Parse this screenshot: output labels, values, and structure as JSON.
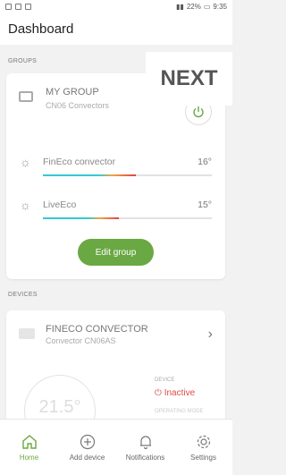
{
  "status_bar": {
    "battery": "22%",
    "time": "9:35"
  },
  "header": {
    "title": "Dashboard"
  },
  "overlay": {
    "text": "NEXT"
  },
  "groups": {
    "label": "GROUPS",
    "group": {
      "name": "MY GROUP",
      "subtitle": "CN06 Convectors",
      "convectors": [
        {
          "name": "FinEco convector",
          "temp": "16°",
          "level": 0.55
        },
        {
          "name": "LiveEco",
          "temp": "15°",
          "level": 0.45
        }
      ],
      "edit_label": "Edit group"
    }
  },
  "devices": {
    "label": "DEVICES",
    "device": {
      "name": "FINECO CONVECTOR",
      "subtitle": "Convector CN06AS",
      "temp": "21.5°",
      "status_label": "DEVICE",
      "status": "Inactive",
      "extra_label": "OPERATING MODE"
    }
  },
  "tabbar": [
    {
      "label": "Home",
      "icon": "home-icon",
      "active": true
    },
    {
      "label": "Add device",
      "icon": "add-icon",
      "active": false
    },
    {
      "label": "Notifications",
      "icon": "bell-icon",
      "active": false
    },
    {
      "label": "Settings",
      "icon": "gear-icon",
      "active": false
    }
  ],
  "colors": {
    "accent": "#6aa843",
    "inactive": "#e04a4a",
    "bar_cyan": "#36c9d2"
  }
}
